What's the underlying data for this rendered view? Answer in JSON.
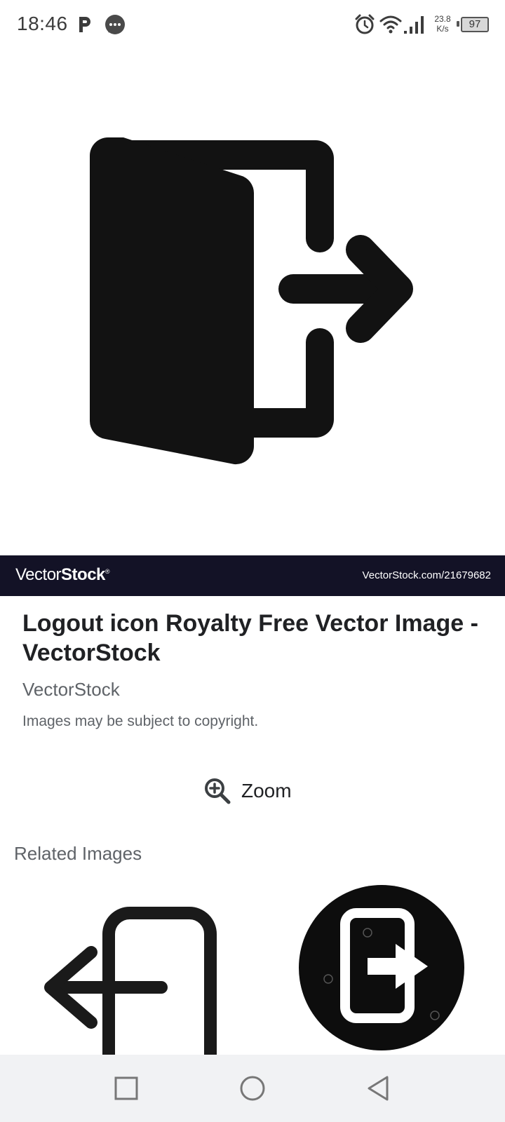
{
  "status_bar": {
    "time": "18:46",
    "net_speed_value": "23.8",
    "net_speed_unit": "K/s",
    "battery": "97",
    "icons": [
      "parking-icon",
      "message-bubble-icon",
      "alarm-icon",
      "wifi-icon",
      "signal-icon",
      "battery-icon"
    ]
  },
  "hero": {
    "icon": "logout-door-arrow-icon"
  },
  "watermark": {
    "logo_light": "Vector",
    "logo_bold": "Stock",
    "logo_mark": "®",
    "url": "VectorStock.com/21679682",
    "background": "#131226"
  },
  "info": {
    "title": "Logout icon Royalty Free Vector Image - VectorStock",
    "source": "VectorStock",
    "copyright": "Images may be subject to copyright."
  },
  "zoom": {
    "label": "Zoom",
    "icon": "zoom-in-icon"
  },
  "related": {
    "heading": "Related Images",
    "items": [
      {
        "icon": "logout-arrow-left-icon"
      },
      {
        "icon": "logout-circle-icon"
      }
    ]
  },
  "nav_bar": {
    "buttons": [
      "recents-square-icon",
      "home-circle-icon",
      "back-triangle-icon"
    ]
  }
}
